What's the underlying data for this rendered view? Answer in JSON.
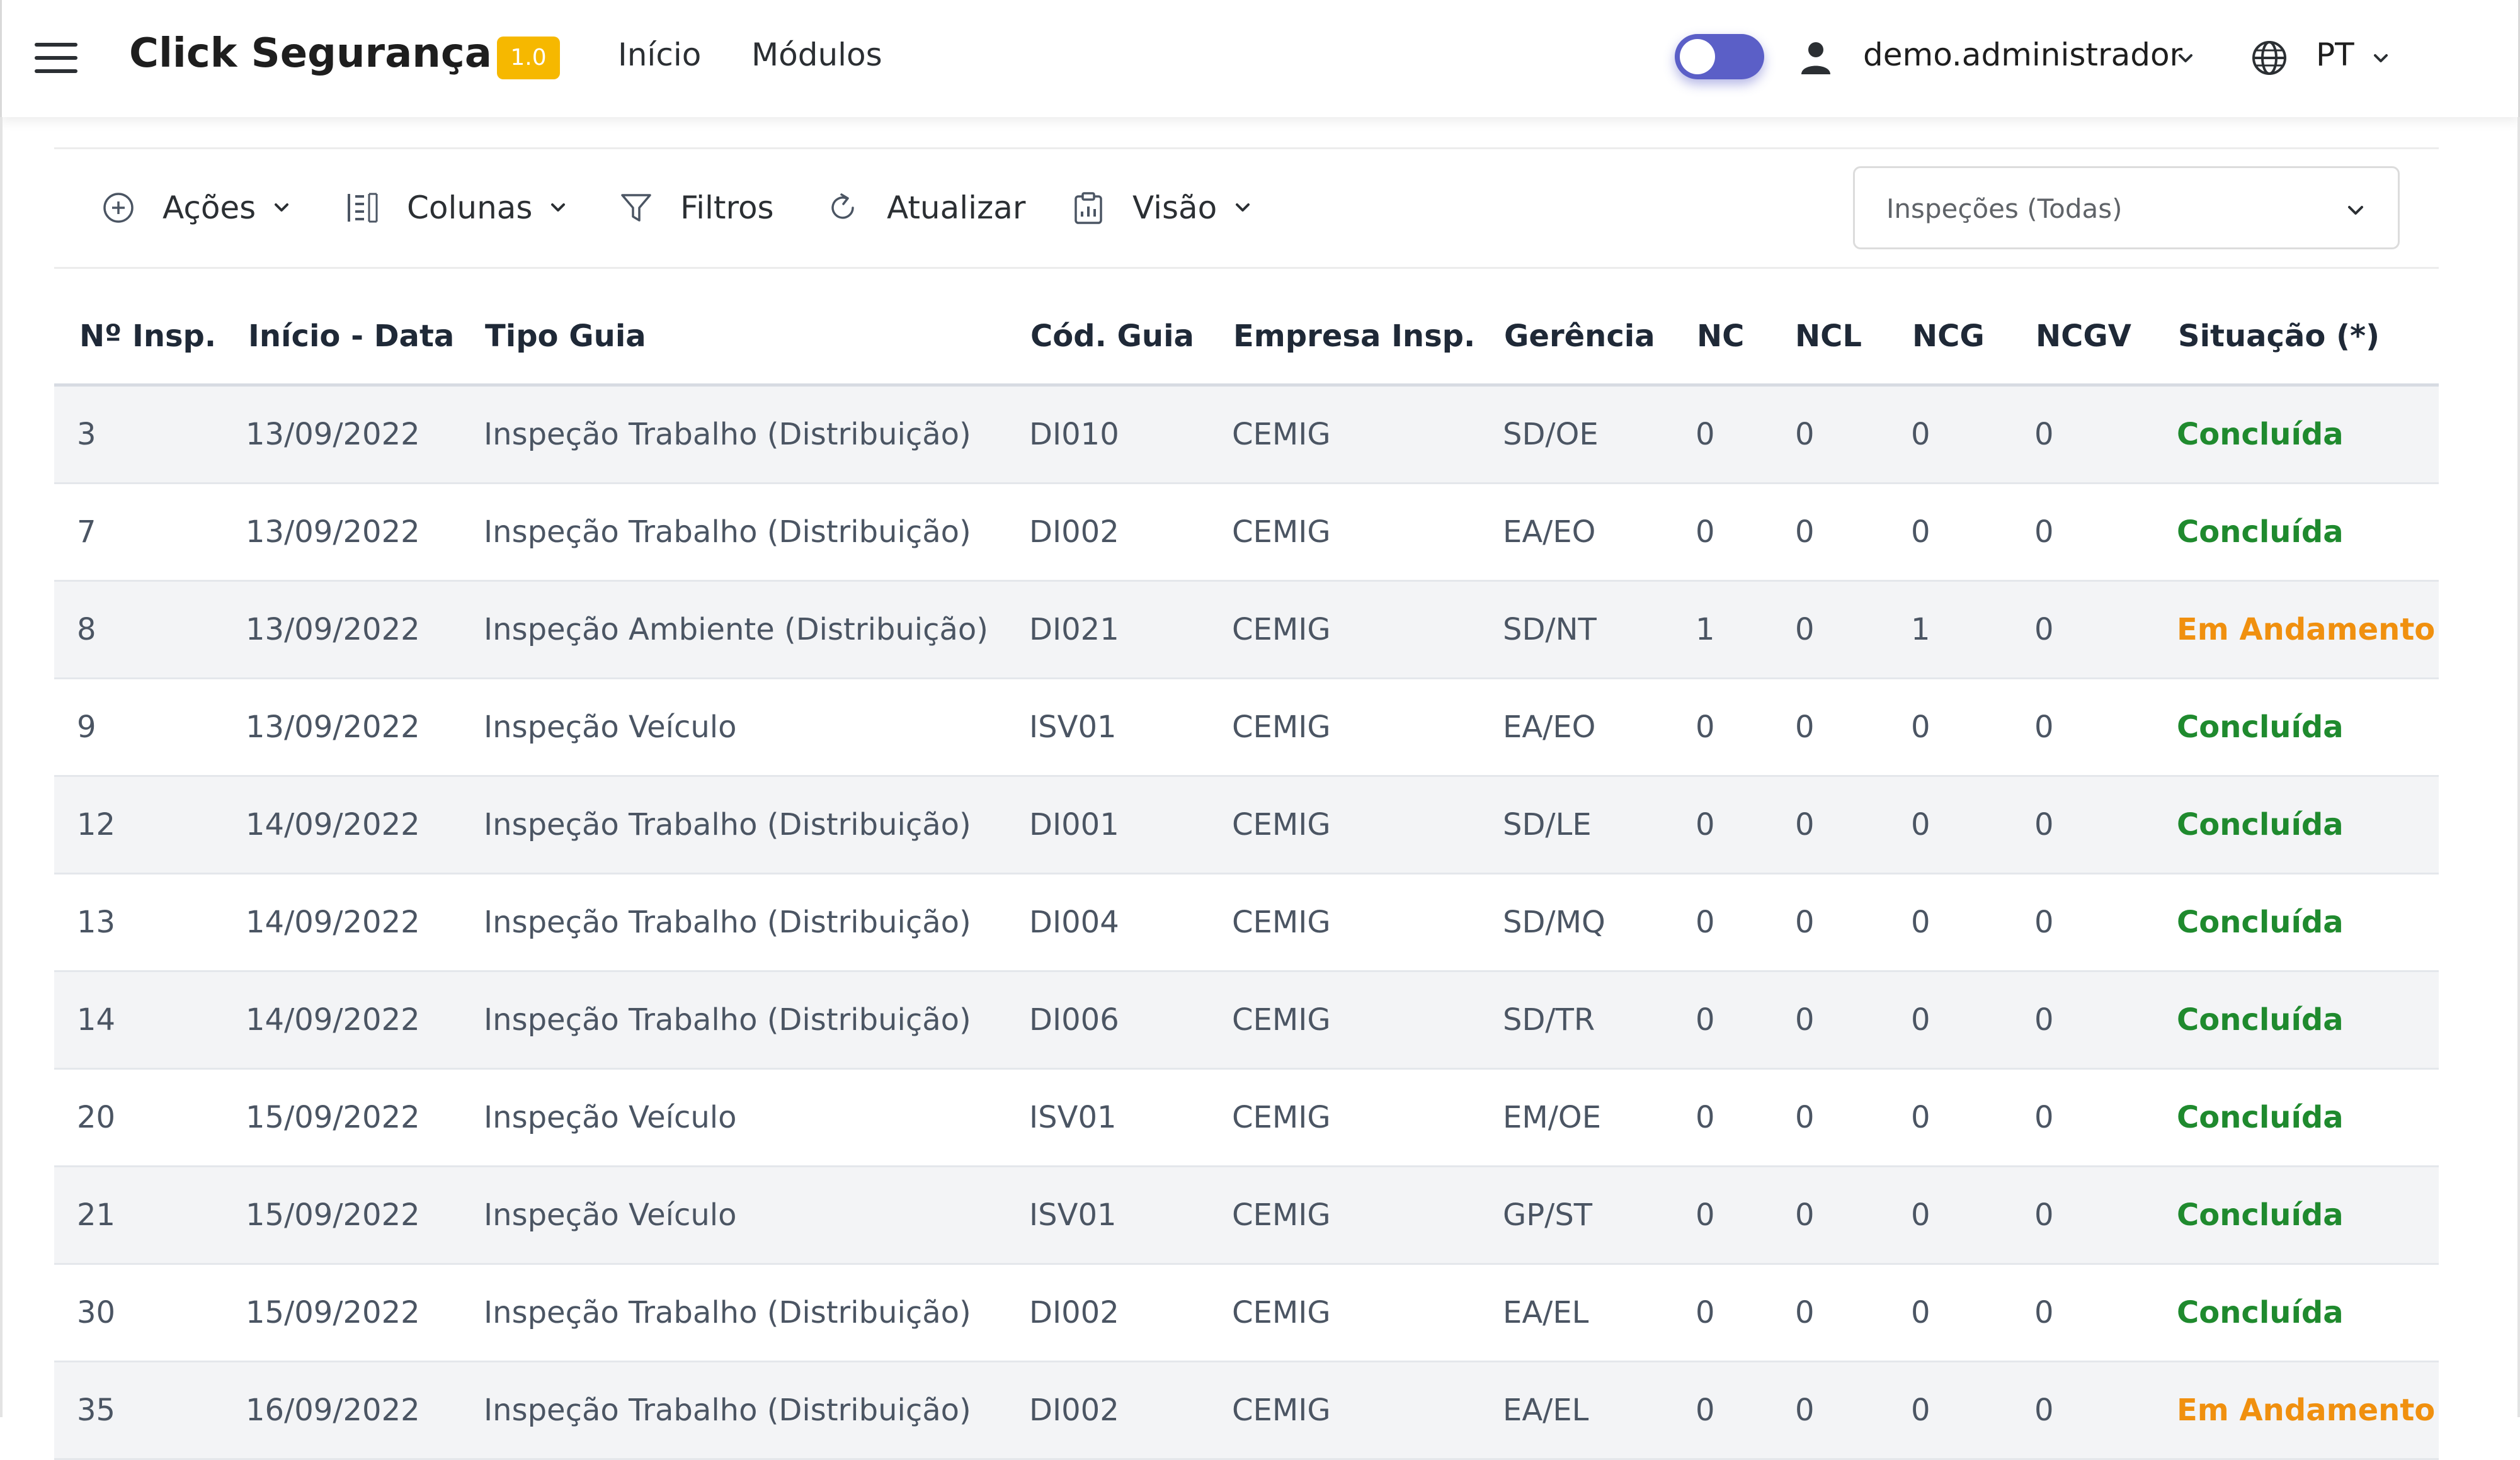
{
  "header": {
    "app_title": "Click Segurança",
    "version_badge": "1.0",
    "nav": {
      "home": "Início",
      "modules": "Módulos"
    },
    "username": "demo.administrador",
    "language": "PT",
    "icons": [
      "menu-icon",
      "user-icon",
      "globe-icon",
      "chevron-down-icon"
    ]
  },
  "toolbar": {
    "actions_label": "Ações",
    "columns_label": "Colunas",
    "filters_label": "Filtros",
    "refresh_label": "Atualizar",
    "view_label": "Visão",
    "filter_select_value": "Inspeções (Todas)"
  },
  "table": {
    "columns": [
      "Nº Insp.",
      "Início - Data",
      "Tipo Guia",
      "Cód. Guia",
      "Empresa Insp.",
      "Gerência",
      "NC",
      "NCL",
      "NCG",
      "NCGV",
      "Situação (*)"
    ],
    "rows": [
      {
        "id": "3",
        "date": "13/09/2022",
        "type": "Inspeção Trabalho (Distribuição)",
        "code": "DI010",
        "company": "CEMIG",
        "mgmt": "SD/OE",
        "nc": "0",
        "ncl": "0",
        "ncg": "0",
        "ncgv": "0",
        "status": "Concluída"
      },
      {
        "id": "7",
        "date": "13/09/2022",
        "type": "Inspeção Trabalho (Distribuição)",
        "code": "DI002",
        "company": "CEMIG",
        "mgmt": "EA/EO",
        "nc": "0",
        "ncl": "0",
        "ncg": "0",
        "ncgv": "0",
        "status": "Concluída"
      },
      {
        "id": "8",
        "date": "13/09/2022",
        "type": "Inspeção Ambiente (Distribuição)",
        "code": "DI021",
        "company": "CEMIG",
        "mgmt": "SD/NT",
        "nc": "1",
        "ncl": "0",
        "ncg": "1",
        "ncgv": "0",
        "status": "Em Andamento"
      },
      {
        "id": "9",
        "date": "13/09/2022",
        "type": "Inspeção Veículo",
        "code": "ISV01",
        "company": "CEMIG",
        "mgmt": "EA/EO",
        "nc": "0",
        "ncl": "0",
        "ncg": "0",
        "ncgv": "0",
        "status": "Concluída"
      },
      {
        "id": "12",
        "date": "14/09/2022",
        "type": "Inspeção Trabalho (Distribuição)",
        "code": "DI001",
        "company": "CEMIG",
        "mgmt": "SD/LE",
        "nc": "0",
        "ncl": "0",
        "ncg": "0",
        "ncgv": "0",
        "status": "Concluída"
      },
      {
        "id": "13",
        "date": "14/09/2022",
        "type": "Inspeção Trabalho (Distribuição)",
        "code": "DI004",
        "company": "CEMIG",
        "mgmt": "SD/MQ",
        "nc": "0",
        "ncl": "0",
        "ncg": "0",
        "ncgv": "0",
        "status": "Concluída"
      },
      {
        "id": "14",
        "date": "14/09/2022",
        "type": "Inspeção Trabalho (Distribuição)",
        "code": "DI006",
        "company": "CEMIG",
        "mgmt": "SD/TR",
        "nc": "0",
        "ncl": "0",
        "ncg": "0",
        "ncgv": "0",
        "status": "Concluída"
      },
      {
        "id": "20",
        "date": "15/09/2022",
        "type": "Inspeção Veículo",
        "code": "ISV01",
        "company": "CEMIG",
        "mgmt": "EM/OE",
        "nc": "0",
        "ncl": "0",
        "ncg": "0",
        "ncgv": "0",
        "status": "Concluída"
      },
      {
        "id": "21",
        "date": "15/09/2022",
        "type": "Inspeção Veículo",
        "code": "ISV01",
        "company": "CEMIG",
        "mgmt": "GP/ST",
        "nc": "0",
        "ncl": "0",
        "ncg": "0",
        "ncgv": "0",
        "status": "Concluída"
      },
      {
        "id": "30",
        "date": "15/09/2022",
        "type": "Inspeção Trabalho (Distribuição)",
        "code": "DI002",
        "company": "CEMIG",
        "mgmt": "EA/EL",
        "nc": "0",
        "ncl": "0",
        "ncg": "0",
        "ncgv": "0",
        "status": "Concluída"
      },
      {
        "id": "35",
        "date": "16/09/2022",
        "type": "Inspeção Trabalho (Distribuição)",
        "code": "DI002",
        "company": "CEMIG",
        "mgmt": "EA/EL",
        "nc": "0",
        "ncl": "0",
        "ncg": "0",
        "ncgv": "0",
        "status": "Em Andamento"
      }
    ]
  },
  "colors": {
    "brand_badge": "#f6b800",
    "toggle": "#5b5fc7",
    "status_done": "#1f8a2e",
    "status_in_progress": "#f0900f"
  }
}
